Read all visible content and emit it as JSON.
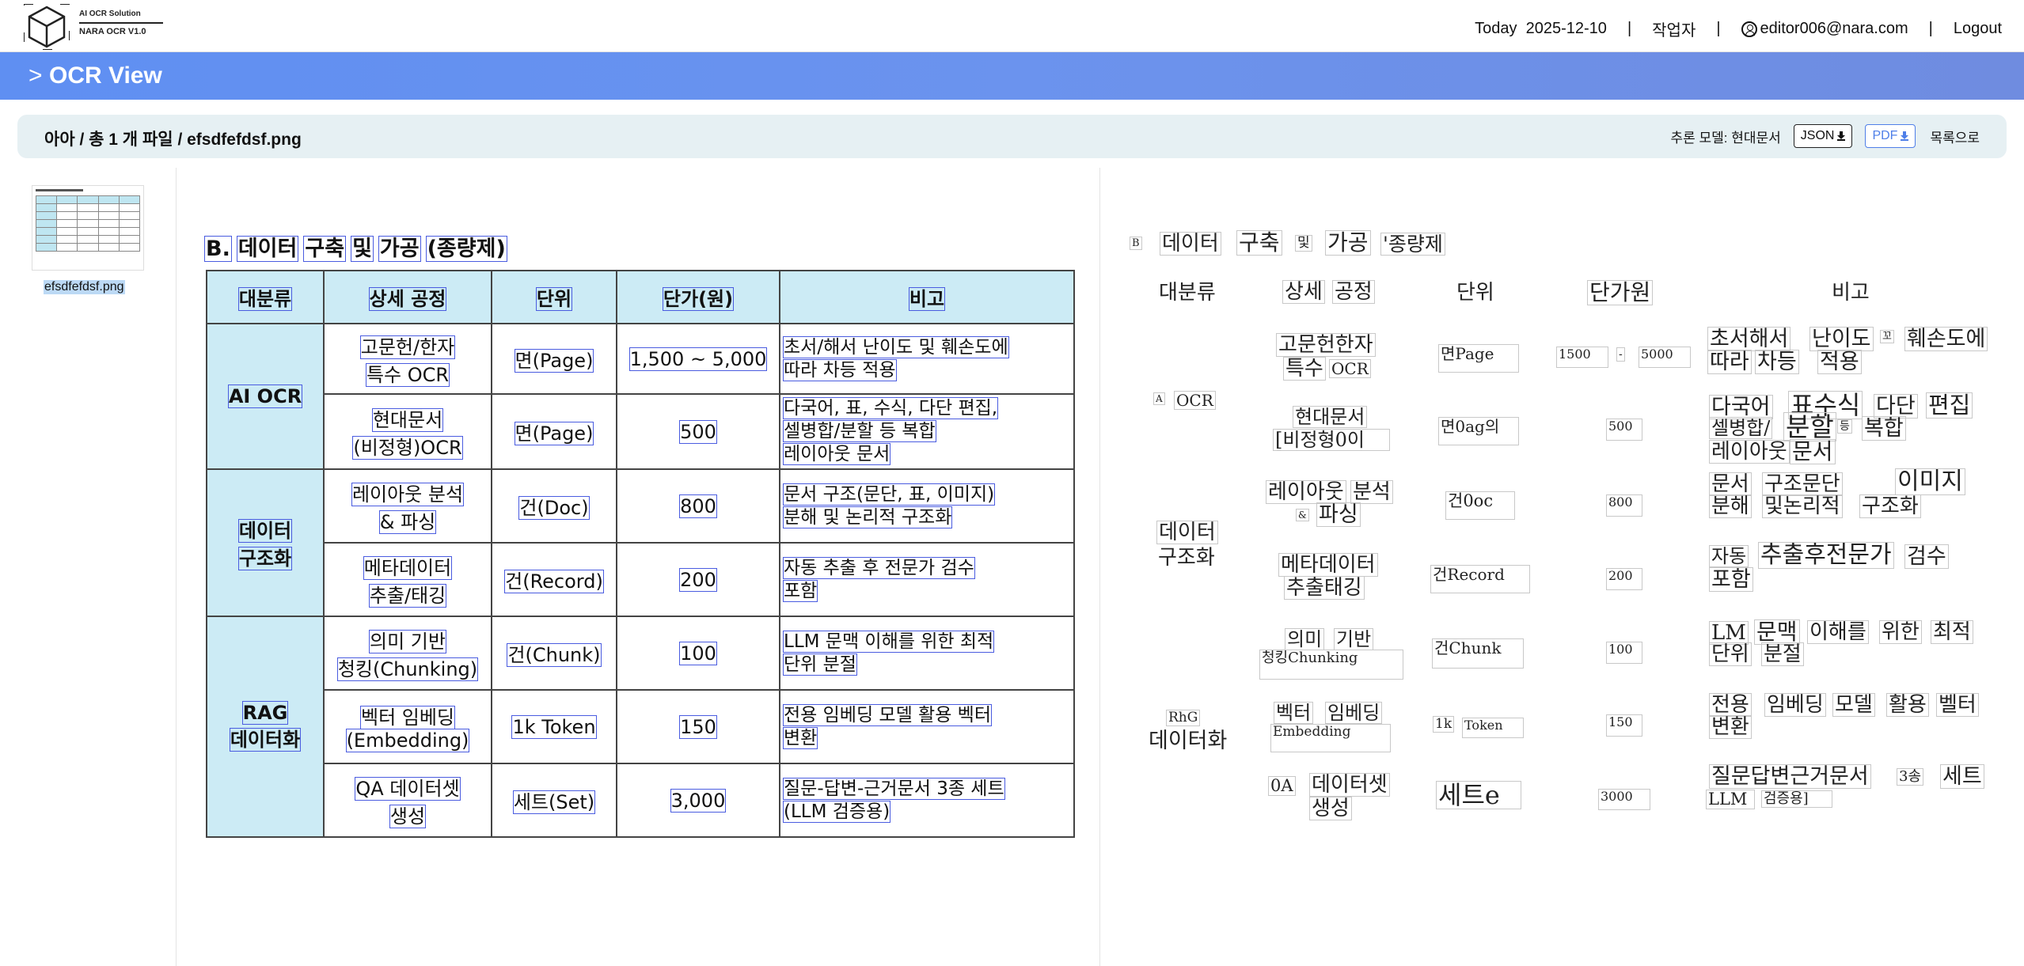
{
  "header": {
    "logo_line1": "AI OCR Solution",
    "logo_line2": "NARA OCR V1.0",
    "today_label": "Today",
    "today_value": "2025-12-10",
    "sep": "|",
    "workspace": "작업자",
    "user_email": "editor006@nara.com",
    "logout": "Logout"
  },
  "banner": {
    "chevron": ">",
    "title": "OCR View"
  },
  "pathbar": {
    "path": "아아 / 총 1 개 파일 / efsdfefdsf.png",
    "model_label": "추론 모델: 현대문서",
    "json_btn": "JSON",
    "pdf_btn": "PDF",
    "list_btn": "목록으로"
  },
  "file_list": [
    {
      "name": "efsdfefdsf.png"
    }
  ],
  "document": {
    "title": [
      "B.",
      "데이터",
      "구축",
      "및",
      "가공",
      "(종량제)"
    ],
    "headers": [
      "대분류",
      "상세 공정",
      "단위",
      "단가(원)",
      "비고"
    ],
    "groups": [
      {
        "category": [
          "AI OCR"
        ],
        "rows": [
          {
            "process": [
              "고문헌/한자",
              "특수 OCR"
            ],
            "unit": "면(Page)",
            "price": "1,500 ~ 5,000",
            "note": [
              "초서/해서 난이도 및 훼손도에",
              "따라 차등 적용"
            ]
          },
          {
            "process": [
              "현대문서",
              "(비정형)OCR"
            ],
            "unit": "면(Page)",
            "price": "500",
            "note": [
              "다국어, 표, 수식, 다단 편집,",
              "셀병합/분할 등 복합",
              "레이아웃 문서"
            ]
          }
        ]
      },
      {
        "category": [
          "데이터",
          "구조화"
        ],
        "rows": [
          {
            "process": [
              "레이아웃 분석",
              "& 파싱"
            ],
            "unit": "건(Doc)",
            "price": "800",
            "note": [
              "문서 구조(문단, 표, 이미지)",
              "분해 및 논리적 구조화"
            ]
          },
          {
            "process": [
              "메타데이터",
              "추출/태깅"
            ],
            "unit": "건(Record)",
            "price": "200",
            "note": [
              "자동 추출 후 전문가 검수",
              "포함"
            ]
          }
        ]
      },
      {
        "category": [
          "RAG",
          "데이터화"
        ],
        "rows": [
          {
            "process": [
              "의미 기반",
              "청킹(Chunking)"
            ],
            "unit": "건(Chunk)",
            "price": "100",
            "note": [
              "LLM 문맥 이해를 위한 최적",
              "단위 분절"
            ]
          },
          {
            "process": [
              "벡터 임베딩",
              "(Embedding)"
            ],
            "unit": "1k Token",
            "price": "150",
            "note": [
              "전용 임베딩 모델 활용 벡터",
              "변환"
            ]
          },
          {
            "process": [
              "QA 데이터셋",
              "생성"
            ],
            "unit": "세트(Set)",
            "price": "3,000",
            "note": [
              "질문-답변-근거문서 3종 세트",
              "(LLM 검증용)"
            ]
          }
        ]
      }
    ]
  },
  "ocr_result": {
    "title": [
      "B",
      "데이터",
      "구축",
      "및",
      "가공",
      "'종량제"
    ],
    "headers": [
      "대분류",
      "상세",
      "공정",
      "단위",
      "단가원",
      "비고"
    ],
    "texts": {
      "ai_ocr_a": "A",
      "ai_ocr_b": "OCR",
      "data_1": "데이터",
      "data_2": "구조화",
      "rag_1": "RhG",
      "rag_2": "데이터화",
      "r1_p1": "고문헌한자",
      "r1_p2a": "특수",
      "r1_p2b": "OCR",
      "r1_u": "면Page",
      "r1_pr1": "1500",
      "r1_pr2": "-",
      "r1_pr3": "5000",
      "r1_n1": "초서해서",
      "r1_n2": "난이도",
      "r1_n3": "꼬",
      "r1_n4": "훼손도에",
      "r1_n5": "따라",
      "r1_n6": "차등",
      "r1_n7": "적용",
      "r2_p1": "현대문서",
      "r2_p2": "[비정형0이",
      "r2_u": "면0ag의",
      "r2_pr": "500",
      "r2_n1": "다국어",
      "r2_n2": "표수식",
      "r2_n3": "다단",
      "r2_n4": "편집",
      "r2_n5": "셀병합/",
      "r2_n6": "분할",
      "r2_n7": "등",
      "r2_n8": "복합",
      "r2_n9": "레이아웃",
      "r2_n10": "문서",
      "r3_p1": "레이아웃",
      "r3_p2": "분석",
      "r3_p3": "&",
      "r3_p4": "파싱",
      "r3_u": "건0oc",
      "r3_pr": "800",
      "r3_n1": "문서",
      "r3_n2": "구조문단",
      "r3_n3": "이미지",
      "r3_n4": "분해",
      "r3_n5": "및논리적",
      "r3_n6": "구조화",
      "r4_p1": "메타데이터",
      "r4_p2": "추출태깅",
      "r4_u": "건Record",
      "r4_pr": "200",
      "r4_n1": "자동",
      "r4_n2": "추출후전문가",
      "r4_n3": "검수",
      "r4_n4": "포함",
      "r5_p1": "의미",
      "r5_p2": "기반",
      "r5_p3": "청킹Chunking",
      "r5_u": "건Chunk",
      "r5_pr": "100",
      "r5_n1": "LM",
      "r5_n2": "문맥",
      "r5_n3": "이해를",
      "r5_n4": "위한",
      "r5_n5": "최적",
      "r5_n6": "단위",
      "r5_n7": "분절",
      "r6_p1": "벡터",
      "r6_p2": "임베딩",
      "r6_p3": "Embedding",
      "r6_u1": "1k",
      "r6_u2": "Token",
      "r6_pr": "150",
      "r6_n1": "전용",
      "r6_n2": "임베딩",
      "r6_n3": "모델",
      "r6_n4": "활용",
      "r6_n5": "벨터",
      "r6_n6": "변환",
      "r7_p1": "0A",
      "r7_p2": "데이터셋",
      "r7_p3": "생성",
      "r7_u": "세트e",
      "r7_pr": "3000",
      "r7_n1": "질문답변근거문서",
      "r7_n2": "3송",
      "r7_n3": "세트",
      "r7_n4": "LLM",
      "r7_n5": "검증용]"
    }
  },
  "colors": {
    "banner": "#6b93ee",
    "table_header": "#ccebf5",
    "box_blue": "#4a5ce0",
    "pathbar_bg": "#e6f0f3"
  }
}
